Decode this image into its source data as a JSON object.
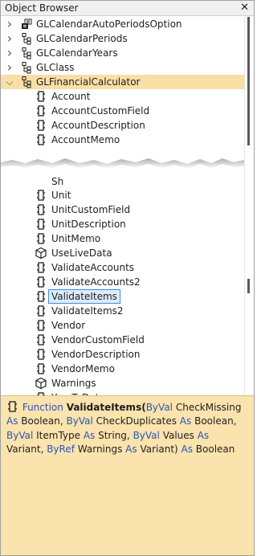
{
  "window": {
    "title": "Object Browser",
    "close_glyph": "✕"
  },
  "tree": {
    "top_items": [
      {
        "label": "GLCalendarAutoPeriodsOption",
        "icon": "enum-icon",
        "expanded": false
      },
      {
        "label": "GLCalendarPeriods",
        "icon": "class-icon",
        "expanded": false
      },
      {
        "label": "GLCalendarYears",
        "icon": "class-icon",
        "expanded": false
      },
      {
        "label": "GLClass",
        "icon": "class-icon",
        "expanded": false
      },
      {
        "label": "GLFinancialCalculator",
        "icon": "class-icon",
        "expanded": true,
        "selected": true
      }
    ],
    "members_before_tear": [
      "Account",
      "AccountCustomField",
      "AccountDescription",
      "AccountMemo"
    ],
    "partial_member": "Sh",
    "members_after_tear": [
      {
        "label": "Unit",
        "icon": "property-icon"
      },
      {
        "label": "UnitCustomField",
        "icon": "property-icon"
      },
      {
        "label": "UnitDescription",
        "icon": "property-icon"
      },
      {
        "label": "UnitMemo",
        "icon": "property-icon"
      },
      {
        "label": "UseLiveData",
        "icon": "cube-icon"
      },
      {
        "label": "ValidateAccounts",
        "icon": "property-icon"
      },
      {
        "label": "ValidateAccounts2",
        "icon": "property-icon"
      },
      {
        "label": "ValidateItems",
        "icon": "property-icon",
        "highlighted": true
      },
      {
        "label": "ValidateItems2",
        "icon": "property-icon"
      },
      {
        "label": "Vendor",
        "icon": "property-icon"
      },
      {
        "label": "VendorCustomField",
        "icon": "property-icon"
      },
      {
        "label": "VendorDescription",
        "icon": "property-icon"
      },
      {
        "label": "VendorMemo",
        "icon": "property-icon"
      },
      {
        "label": "Warnings",
        "icon": "cube-icon"
      },
      {
        "label": "YearToDate",
        "icon": "property-icon",
        "clipped": true
      }
    ]
  },
  "description": {
    "kw_function": "Function",
    "name": "ValidateItems",
    "p1": "(",
    "byval1": "ByVal",
    "a1": " CheckMissing ",
    "as1": "As",
    "t1": " Boolean, ",
    "byval2": "ByVal",
    "a2": " CheckDuplicates ",
    "as2": "As",
    "t2": " Boolean, ",
    "byval3": "ByVal",
    "a3": " ItemType ",
    "as3": "As",
    "t3": " String, ",
    "byval4": "ByVal",
    "a4": " Values ",
    "as4": "As",
    "t4": " Variant, ",
    "byref": "ByRef",
    "a5": " Warnings ",
    "as5": "As",
    "t5": " Variant) ",
    "as6": "As",
    "t6": " Boolean"
  },
  "colors": {
    "selection_row": "#f9dfa6",
    "description_bg": "#fbe3ad",
    "keyword": "#2a55b5",
    "highlight_border": "#3c8cd7"
  }
}
